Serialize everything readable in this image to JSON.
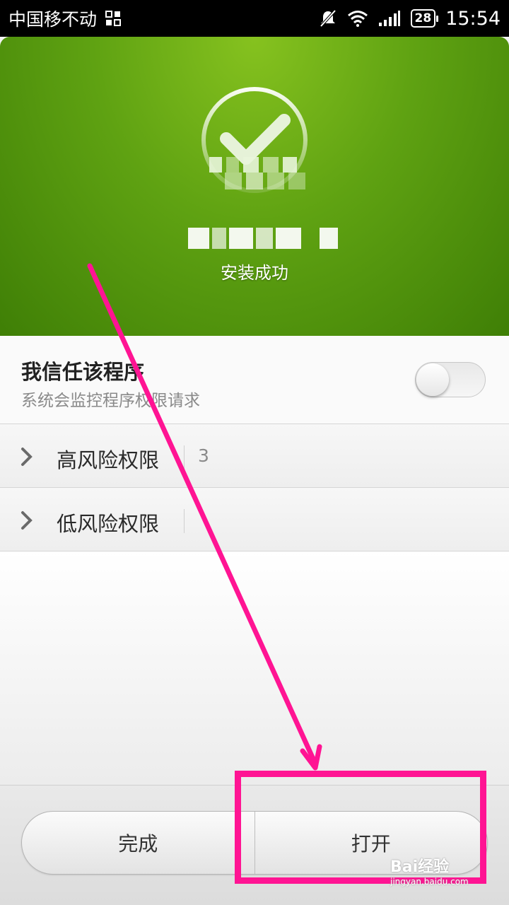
{
  "status_bar": {
    "carrier": "中国移不动",
    "battery": "28",
    "time": "15:54"
  },
  "header": {
    "status": "安装成功"
  },
  "trust": {
    "title": "我信任该程序",
    "subtitle": "系统会监控程序权限请求",
    "toggle_on": false
  },
  "permissions": [
    {
      "label": "高风险权限",
      "count": "3"
    },
    {
      "label": "低风险权限",
      "count": ""
    }
  ],
  "buttons": {
    "done": "完成",
    "open": "打开"
  },
  "watermark": {
    "brand": "Bai经验",
    "url": "jingyan.baidu.com"
  },
  "colors": {
    "accent_green": "#6aae16",
    "annotation": "#ff1493"
  }
}
